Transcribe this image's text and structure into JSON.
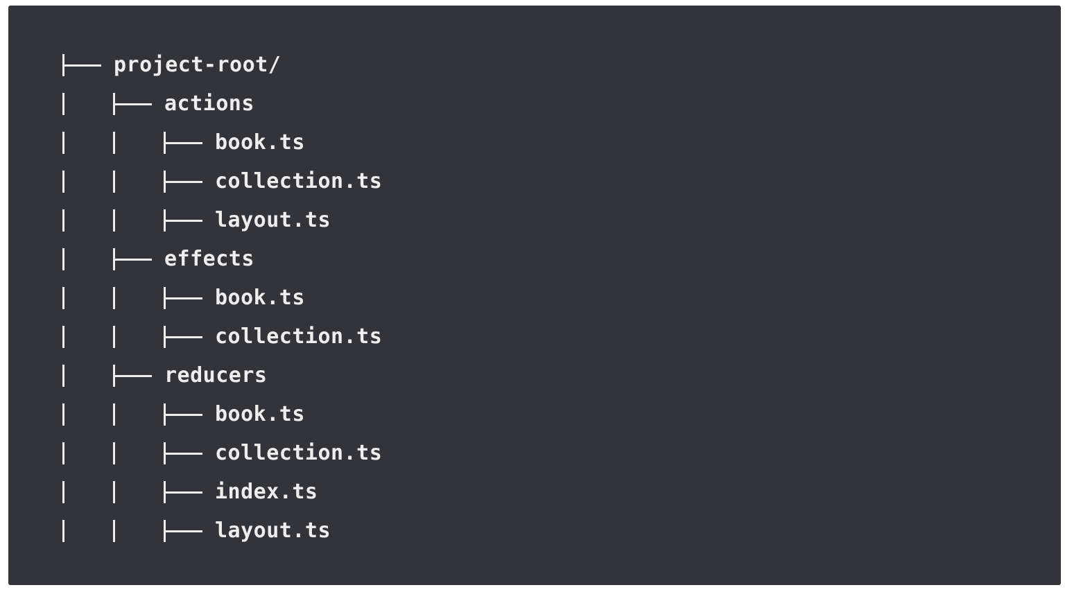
{
  "colors": {
    "panel_background": "#333439",
    "text": "#eeeeee"
  },
  "tree": [
    {
      "depth": 0,
      "label": "project-root/"
    },
    {
      "depth": 1,
      "label": "actions"
    },
    {
      "depth": 2,
      "label": "book.ts"
    },
    {
      "depth": 2,
      "label": "collection.ts"
    },
    {
      "depth": 2,
      "label": "layout.ts"
    },
    {
      "depth": 1,
      "label": "effects"
    },
    {
      "depth": 2,
      "label": "book.ts"
    },
    {
      "depth": 2,
      "label": "collection.ts"
    },
    {
      "depth": 1,
      "label": "reducers"
    },
    {
      "depth": 2,
      "label": "book.ts"
    },
    {
      "depth": 2,
      "label": "collection.ts"
    },
    {
      "depth": 2,
      "label": "index.ts"
    },
    {
      "depth": 2,
      "label": "layout.ts"
    }
  ]
}
